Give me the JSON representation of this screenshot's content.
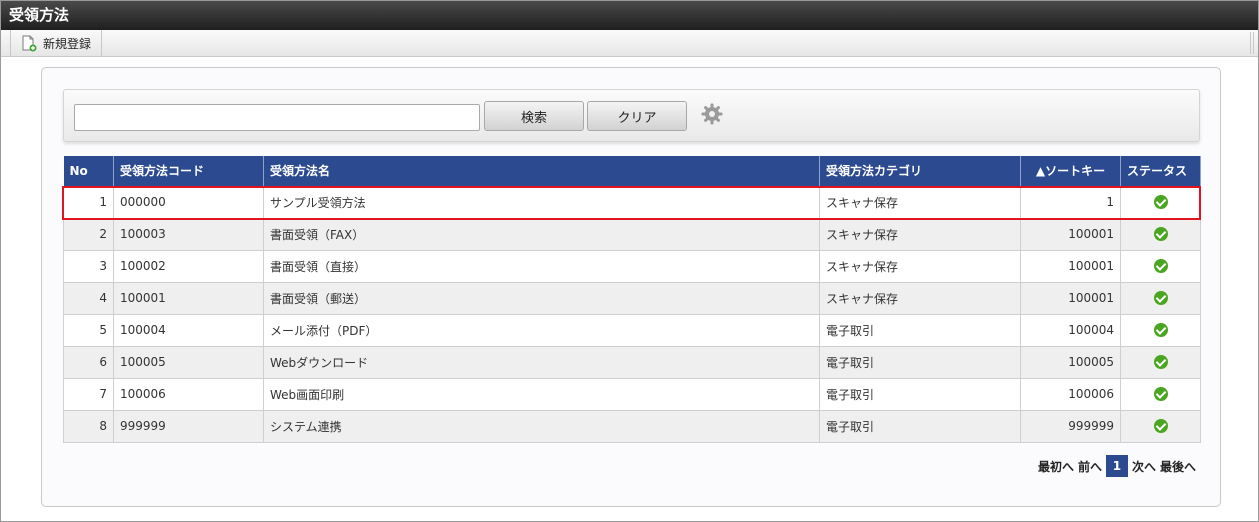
{
  "title": "受領方法",
  "toolbar": {
    "new_label": "新規登録"
  },
  "search": {
    "value": "",
    "search_label": "検索",
    "clear_label": "クリア"
  },
  "table": {
    "headers": {
      "no": "No",
      "code": "受領方法コード",
      "name": "受領方法名",
      "category": "受領方法カテゴリ",
      "sortkey": "▲ソートキー",
      "status": "ステータス"
    },
    "rows": [
      {
        "no": "1",
        "code": "000000",
        "name": "サンプル受領方法",
        "category": "スキャナ保存",
        "sortkey": "1",
        "status": "active"
      },
      {
        "no": "2",
        "code": "100003",
        "name": "書面受領（FAX）",
        "category": "スキャナ保存",
        "sortkey": "100001",
        "status": "active"
      },
      {
        "no": "3",
        "code": "100002",
        "name": "書面受領（直接）",
        "category": "スキャナ保存",
        "sortkey": "100001",
        "status": "active"
      },
      {
        "no": "4",
        "code": "100001",
        "name": "書面受領（郵送）",
        "category": "スキャナ保存",
        "sortkey": "100001",
        "status": "active"
      },
      {
        "no": "5",
        "code": "100004",
        "name": "メール添付（PDF）",
        "category": "電子取引",
        "sortkey": "100004",
        "status": "active"
      },
      {
        "no": "6",
        "code": "100005",
        "name": "Webダウンロード",
        "category": "電子取引",
        "sortkey": "100005",
        "status": "active"
      },
      {
        "no": "7",
        "code": "100006",
        "name": "Web画面印刷",
        "category": "電子取引",
        "sortkey": "100006",
        "status": "active"
      },
      {
        "no": "8",
        "code": "999999",
        "name": "システム連携",
        "category": "電子取引",
        "sortkey": "999999",
        "status": "active"
      }
    ]
  },
  "pager": {
    "first": "最初へ",
    "prev": "前へ",
    "current": "1",
    "next": "次へ",
    "last": "最後へ"
  },
  "colors": {
    "header": "#2c4a8f",
    "status_ok": "#4aa521",
    "highlight": "#e0141e"
  }
}
